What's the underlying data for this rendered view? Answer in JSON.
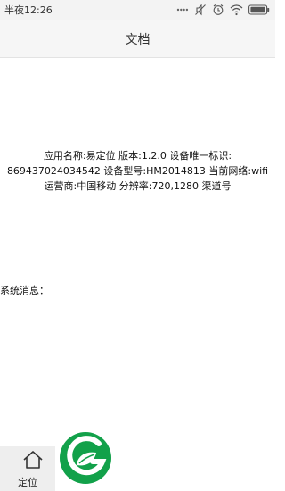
{
  "status_bar": {
    "time": "半夜12:26",
    "icons": [
      "signal-dots-icon",
      "mute-icon",
      "alarm-icon",
      "wifi-icon",
      "battery-icon"
    ]
  },
  "header": {
    "title": "文档"
  },
  "info": {
    "line1": "应用名称:易定位 版本:1.2.0 设备唯一标识:",
    "line2": "869437024034542 设备型号:HM2014813 当前网络:wifi",
    "line3": "运营商:中国移动 分辨率:720,1280 渠道号"
  },
  "system_message": {
    "label": "系统消息："
  },
  "bottom_nav": {
    "tab_label": "定位",
    "tab_icon": "home-icon"
  },
  "logo": {
    "icon": "leaf-g-logo-icon",
    "colors": {
      "green": "#12a14a",
      "white": "#ffffff"
    }
  },
  "colors": {
    "status_bar_bg": "#f3f3f3",
    "header_bg": "#f6f6f6",
    "tab_bg": "#eeeeee"
  }
}
